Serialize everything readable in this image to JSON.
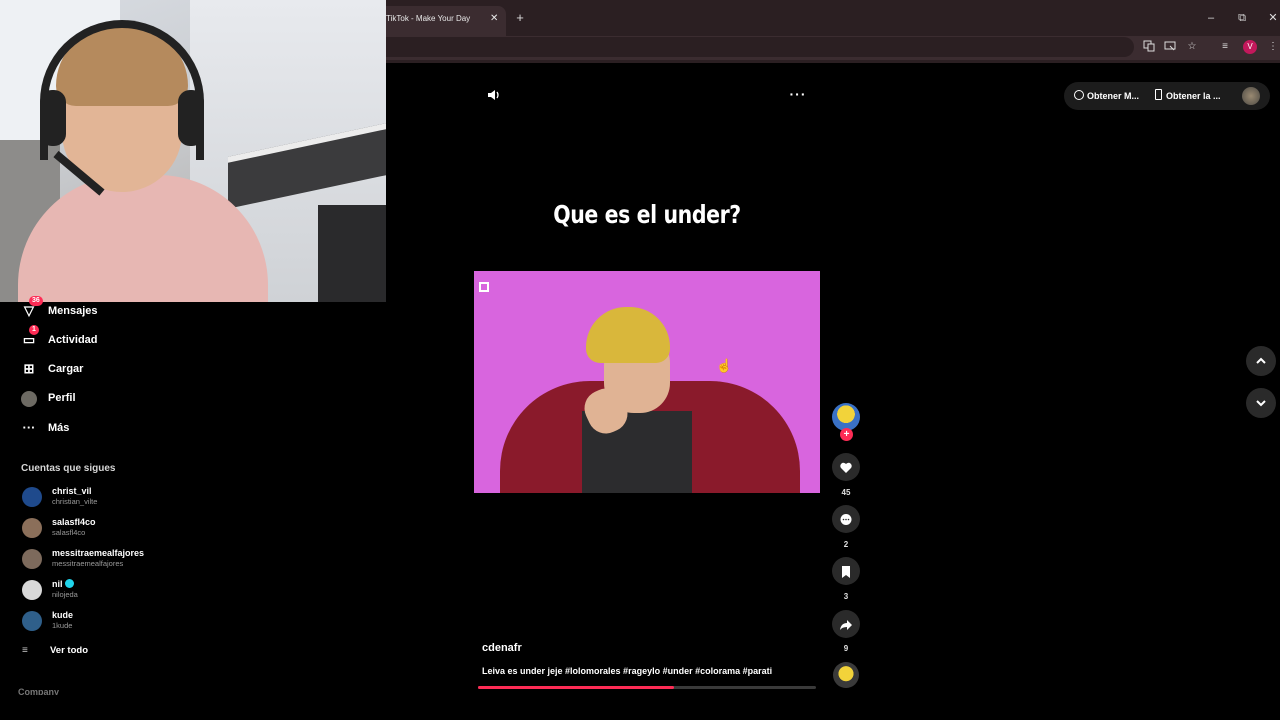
{
  "browser": {
    "tab_title": "TikTok - Make Your Day",
    "tab_close": "✕",
    "new_tab": "+",
    "window_controls": {
      "minimize": "–",
      "restore": "⧉",
      "close": "✕"
    },
    "toolbar_icons": [
      "translate-icon",
      "cast-icon",
      "star-icon",
      "reading-list-icon"
    ],
    "profile_initial": "V",
    "menu": "⋮"
  },
  "sidebar": {
    "items": [
      {
        "label": "Mensajes",
        "icon": "messages-icon",
        "badge": "36"
      },
      {
        "label": "Actividad",
        "icon": "activity-icon",
        "badge": "1"
      },
      {
        "label": "Cargar",
        "icon": "upload-icon",
        "badge": ""
      },
      {
        "label": "Perfil",
        "icon": "profile-icon",
        "badge": ""
      },
      {
        "label": "Más",
        "icon": "more-icon",
        "badge": ""
      }
    ],
    "following_title": "Cuentas que sigues",
    "accounts": [
      {
        "name": "christ_vil",
        "handle": "christian_vilte",
        "verified": false,
        "color": "#1f4a8c"
      },
      {
        "name": "salasfl4co",
        "handle": "salasfl4co",
        "verified": false,
        "color": "#8b6f5a"
      },
      {
        "name": "messitraemealfajores",
        "handle": "messitraemealfajores",
        "verified": false,
        "color": "#7d6a5c"
      },
      {
        "name": "nil",
        "handle": "nilojeda",
        "verified": true,
        "color": "#d8d8d8"
      },
      {
        "name": "kude",
        "handle": "1kude",
        "verified": false,
        "color": "#2f5f8a"
      }
    ],
    "see_all": "Ver todo",
    "footer": "Company"
  },
  "video": {
    "title": "Que es el under?",
    "author": "cdenafr",
    "caption": "Leiva es under jeje #lolomorales #rageylo #under #colorama #parati",
    "progress": 0.58,
    "background_color": "#d865de"
  },
  "actions": {
    "likes": "45",
    "comments": "2",
    "saves": "3",
    "shares": "9"
  },
  "top_right": {
    "get_coins": "Obtener M...",
    "get_app": "Obtener la ..."
  },
  "colors": {
    "accent": "#fe2c55",
    "chrome": "#2b1f22"
  }
}
